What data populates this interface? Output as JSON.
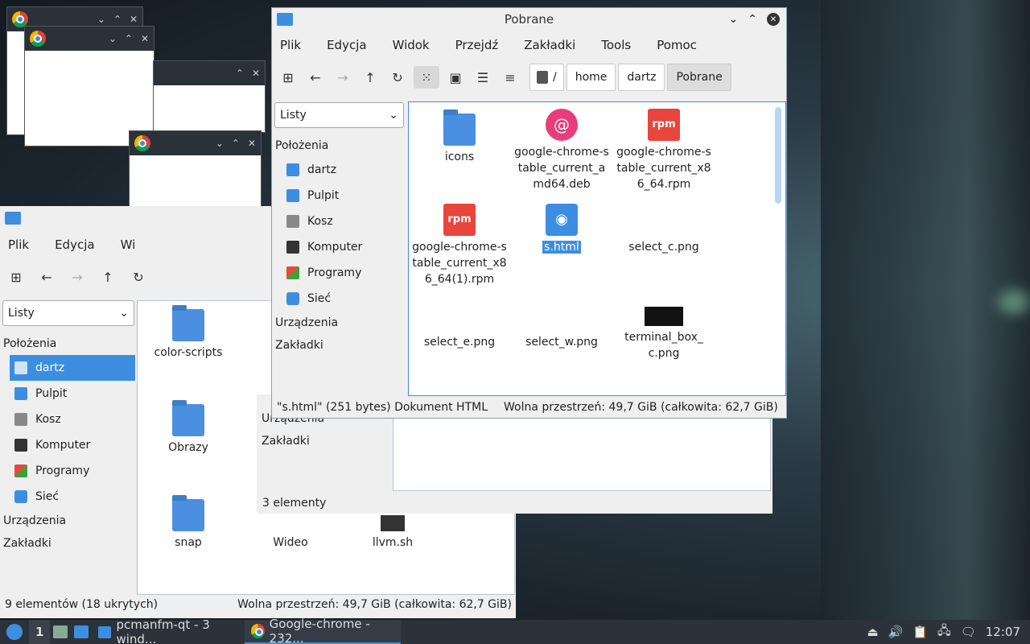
{
  "desktop": {},
  "chrome_ghosts": {
    "title": ""
  },
  "back_window": {
    "menu": [
      "Plik",
      "Edycja",
      "Wi"
    ],
    "view_combo": "Listy",
    "sidebar": {
      "places_header": "Położenia",
      "items": [
        "dartz",
        "Pulpit",
        "Kosz",
        "Komputer",
        "Programy",
        "Sieć"
      ],
      "devices_header": "Urządzenia",
      "bookmarks_header": "Zakładki"
    },
    "files": [
      "color-scripts",
      "Obrazy",
      "snap",
      "Wideo",
      "llvm.sh"
    ],
    "status_left": "9 elementów (18 ukrytych)",
    "status_right": "Wolna przestrzeń: 49,7 GiB (całkowita: 62,7 GiB)"
  },
  "mid_window": {
    "devices_header": "Urządzenia",
    "bookmarks_header": "Zakładki",
    "status_left": "3 elementy"
  },
  "front_window": {
    "title": "Pobrane",
    "menu": [
      "Plik",
      "Edycja",
      "Widok",
      "Przejdź",
      "Zakładki",
      "Tools",
      "Pomoc"
    ],
    "path": [
      "/",
      "home",
      "dartz",
      "Pobrane"
    ],
    "view_combo": "Listy",
    "sidebar": {
      "places_header": "Położenia",
      "items": [
        "dartz",
        "Pulpit",
        "Kosz",
        "Komputer",
        "Programy",
        "Sieć"
      ],
      "devices_header": "Urządzenia",
      "bookmarks_header": "Zakładki"
    },
    "files": [
      {
        "name": "icons",
        "icon": "folder-icon"
      },
      {
        "name": "google-chrome-stable_current_amd64.deb",
        "icon": "deb-icon"
      },
      {
        "name": "google-chrome-stable_current_x86_64.rpm",
        "icon": "rpm-icon"
      },
      {
        "name": "google-chrome-stable_current_x86_64(1).rpm",
        "icon": "rpm-icon"
      },
      {
        "name": "s.html",
        "icon": "html-icon",
        "selected": true
      },
      {
        "name": "select_c.png",
        "icon": "image-icon"
      },
      {
        "name": "select_e.png",
        "icon": "image-icon"
      },
      {
        "name": "select_w.png",
        "icon": "image-icon"
      },
      {
        "name": "terminal_box_c.png",
        "icon": "image-icon"
      }
    ],
    "rpm_label": "rpm",
    "status_left": "\"s.html\" (251 bytes) Dokument HTML",
    "status_right": "Wolna przestrzeń: 49,7 GiB (całkowita: 62,7 GiB)"
  },
  "taskbar": {
    "desktop_num": "1",
    "task1": "pcmanfm-qt - 3 wind...",
    "task2": "Google-chrome - 232...",
    "clock": "12:07"
  },
  "colors": {
    "accent": "#3d8ee0",
    "taskbar": "#2c323a"
  }
}
